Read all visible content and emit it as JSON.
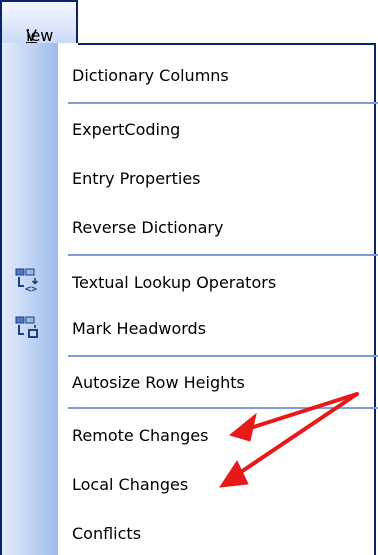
{
  "menu_title": "View",
  "menu_title_accel": "V",
  "menu_title_rest": "iew",
  "items": [
    {
      "label": "Dictionary Columns"
    },
    {
      "label": "ExpertCoding"
    },
    {
      "label": "Entry Properties"
    },
    {
      "label": "Reverse Dictionary"
    },
    {
      "label": "Textual Lookup Operators",
      "icon": "textual-lookup-operators-icon"
    },
    {
      "label": "Mark Headwords",
      "icon": "mark-headwords-icon"
    },
    {
      "label": "Autosize Row Heights"
    },
    {
      "label": "Remote Changes"
    },
    {
      "label": "Local Changes"
    },
    {
      "label": "Conflicts"
    }
  ],
  "colors": {
    "menu_border": "#0a246a",
    "separator": "#7f9ddb",
    "gutter_light": "#e3ecfc",
    "gutter_dark": "#9ebbe9",
    "annotation_arrow": "#e8191a"
  }
}
